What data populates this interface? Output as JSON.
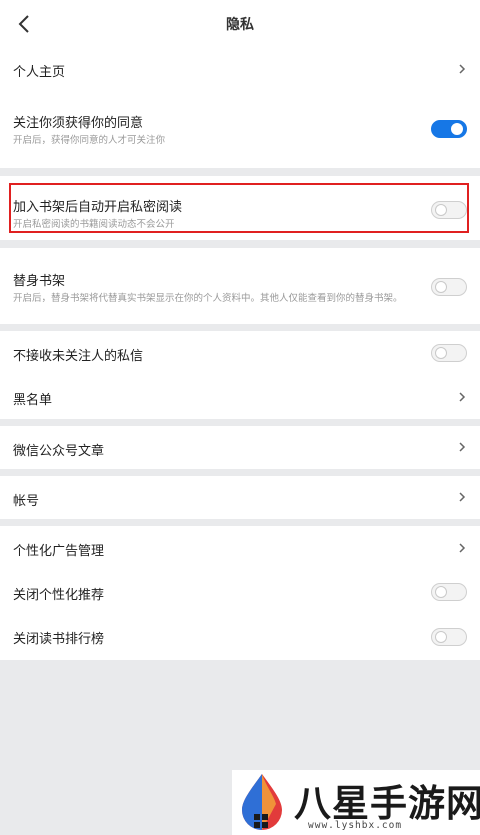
{
  "header": {
    "title": "隐私"
  },
  "group1": {
    "item_profile": {
      "label": "个人主页"
    },
    "item_follow_consent": {
      "label": "关注你须获得你的同意",
      "sub": "开启后，获得你同意的人才可关注你",
      "toggle": "on"
    }
  },
  "group2": {
    "item_private_reading": {
      "label": "加入书架后自动开启私密阅读",
      "sub": "开启私密阅读的书籍阅读动态不会公开",
      "toggle": "off"
    }
  },
  "group3": {
    "item_substitute_shelf": {
      "label": "替身书架",
      "sub": "开启后，替身书架将代替真实书架显示在你的个人资料中。其他人仅能查看到你的替身书架。",
      "toggle": "off"
    }
  },
  "group4": {
    "item_no_dm": {
      "label": "不接收未关注人的私信",
      "toggle": "off"
    },
    "item_blacklist": {
      "label": "黑名单"
    }
  },
  "group5": {
    "item_wechat_articles": {
      "label": "微信公众号文章"
    }
  },
  "group6": {
    "item_account": {
      "label": "帐号"
    }
  },
  "group7": {
    "item_ad_management": {
      "label": "个性化广告管理"
    },
    "item_close_personalized": {
      "label": "关闭个性化推荐",
      "toggle": "off"
    },
    "item_close_ranking": {
      "label": "关闭读书排行榜",
      "toggle": "off"
    }
  },
  "watermark": {
    "text": "八星手游网",
    "url": "www.lyshbx.com"
  },
  "colors": {
    "accent": "#1677e6",
    "highlight": "#e02020",
    "background": "#e9eaec"
  }
}
